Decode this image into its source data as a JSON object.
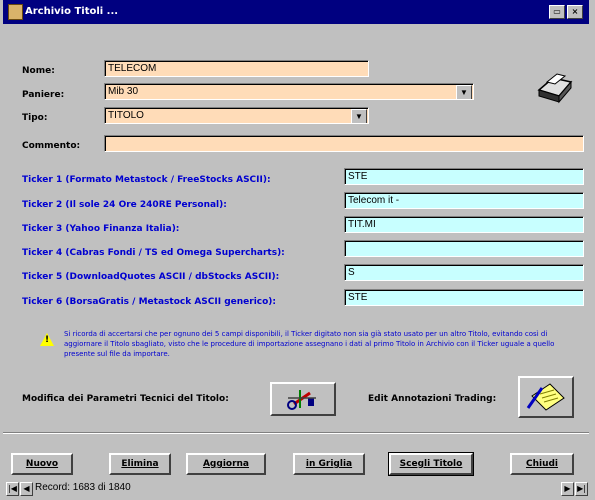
{
  "window": {
    "title": "Archivio Titoli ..."
  },
  "form": {
    "nome": {
      "label": "Nome:",
      "value": "TELECOM"
    },
    "paniere": {
      "label": "Paniere:",
      "value": "Mib 30"
    },
    "tipo": {
      "label": "Tipo:",
      "value": "TITOLO"
    },
    "commento": {
      "label": "Commento:",
      "value": ""
    }
  },
  "tickers": [
    {
      "label": "Ticker 1  (Formato Metastock / FreeStocks ASCII):",
      "value": "STE"
    },
    {
      "label": "Ticker 2  (Il sole 24 Ore 240RE Personal):",
      "value": "Telecom it -"
    },
    {
      "label": "Ticker 3  (Yahoo Finanza Italia):",
      "value": "TIT.MI"
    },
    {
      "label": "Ticker 4  (Cabras Fondi / TS ed Omega Supercharts):",
      "value": ""
    },
    {
      "label": "Ticker 5  (DownloadQuotes ASCII / dbStocks ASCII):",
      "value": "S"
    },
    {
      "label": "Ticker 6  (BorsaGratis / Metastock ASCII generico):",
      "value": "STE"
    }
  ],
  "warning": {
    "text": "Si ricorda di accertarsi che per ognuno dei 5 campi disponibili, il Ticker digitato non sia già stato usato per un altro Titolo, evitando così di aggiornare il Titolo sbagliato, visto che le procedure di importazione assegnano i dati al primo Titolo in Archivio con il Ticker uguale a quello presente sul file da importare."
  },
  "tech_params": {
    "label": "Modifica dei Parametri Tecnici del Titolo:"
  },
  "annotations": {
    "label": "Edit Annotazioni Trading:"
  },
  "buttons": {
    "nuovo": "Nuovo",
    "elimina": "Elimina",
    "aggiorna": "Aggiorna",
    "griglia": "in Griglia",
    "scegli": "Scegli Titolo",
    "chiudi": "Chiudi"
  },
  "status": {
    "record": "Record: 1683 di 1840"
  }
}
